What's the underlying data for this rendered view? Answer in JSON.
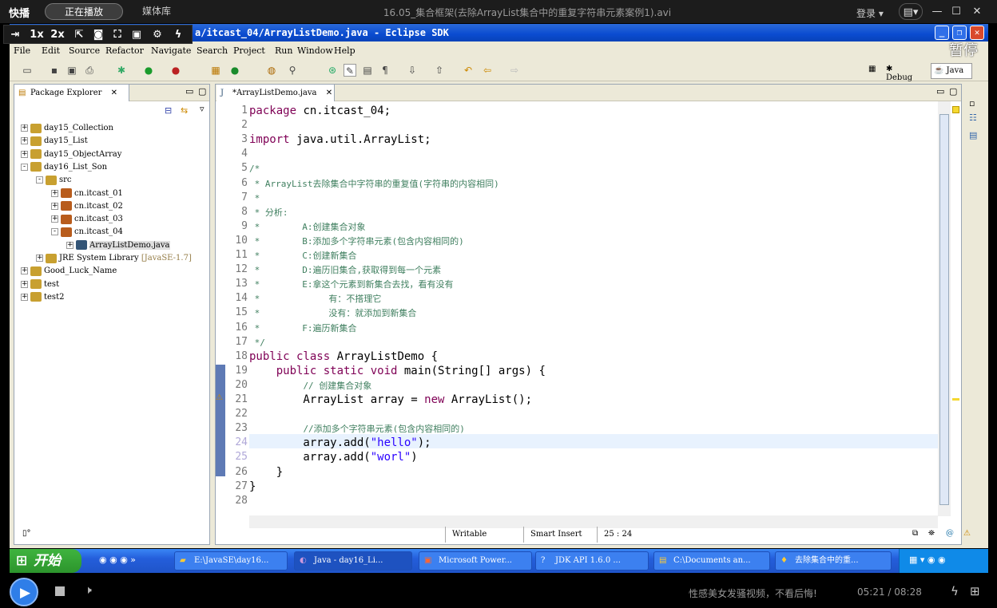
{
  "player": {
    "brand": "快播",
    "tabs": [
      "正在播放",
      "媒体库"
    ],
    "title": "16.05_集合框架(去除ArrayList集合中的重复字符串元素案例1).avi",
    "login": "登录",
    "speed_1x": "1x",
    "speed_2x": "2x",
    "pause_overlay": "暂停",
    "ad_text": "性感美女发骚视频，不看后悔!",
    "time": "05:21 / 08:28",
    "accent": "#2f7ee8"
  },
  "eclipse": {
    "title": "a/itcast_04/ArrayListDemo.java - Eclipse SDK",
    "menu": [
      "File",
      "Edit",
      "Source",
      "Refactor",
      "Navigate",
      "Search",
      "Project",
      "Run",
      "Window",
      "Help"
    ],
    "perspectives": [
      "Debug",
      "Java"
    ],
    "package_explorer": {
      "title": "Package Explorer",
      "items": [
        {
          "label": "day15_Collection",
          "depth": 0,
          "expander": "+"
        },
        {
          "label": "day15_List",
          "depth": 0,
          "expander": "+"
        },
        {
          "label": "day15_ObjectArray",
          "depth": 0,
          "expander": "+"
        },
        {
          "label": "day16_List_Son",
          "depth": 0,
          "expander": "-"
        },
        {
          "label": "src",
          "depth": 1,
          "expander": "-"
        },
        {
          "label": "cn.itcast_01",
          "depth": 2,
          "expander": "+"
        },
        {
          "label": "cn.itcast_02",
          "depth": 2,
          "expander": "+"
        },
        {
          "label": "cn.itcast_03",
          "depth": 2,
          "expander": "+"
        },
        {
          "label": "cn.itcast_04",
          "depth": 2,
          "expander": "-"
        },
        {
          "label": "ArrayListDemo.java",
          "depth": 3,
          "expander": "+"
        },
        {
          "label": "JRE System Library",
          "depth": 1,
          "expander": "+",
          "suffix": "[JavaSE-1.7]"
        },
        {
          "label": "Good_Luck_Name",
          "depth": 0,
          "expander": "+"
        },
        {
          "label": "test",
          "depth": 0,
          "expander": "+"
        },
        {
          "label": "test2",
          "depth": 0,
          "expander": "+"
        }
      ]
    },
    "editor": {
      "tab": "*ArrayListDemo.java",
      "lines": [
        {
          "n": "1",
          "parts": [
            [
              "kw",
              "package"
            ],
            [
              "",
              " cn.itcast_04;"
            ]
          ]
        },
        {
          "n": "2",
          "parts": []
        },
        {
          "n": "3",
          "parts": [
            [
              "kw",
              "import"
            ],
            [
              "",
              " java.util.ArrayList;"
            ]
          ]
        },
        {
          "n": "4",
          "parts": []
        },
        {
          "n": "5",
          "parts": [
            [
              "cm",
              "/*"
            ]
          ]
        },
        {
          "n": "6",
          "parts": [
            [
              "cm",
              " * ArrayList去除集合中字符串的重复值(字符串的内容相同)"
            ]
          ]
        },
        {
          "n": "7",
          "parts": [
            [
              "cm",
              " *"
            ]
          ]
        },
        {
          "n": "8",
          "parts": [
            [
              "cm",
              " * 分析:"
            ]
          ]
        },
        {
          "n": "9",
          "parts": [
            [
              "cm",
              " *        A:创建集合对象"
            ]
          ]
        },
        {
          "n": "10",
          "parts": [
            [
              "cm",
              " *        B:添加多个字符串元素(包含内容相同的)"
            ]
          ]
        },
        {
          "n": "11",
          "parts": [
            [
              "cm",
              " *        C:创建新集合"
            ]
          ]
        },
        {
          "n": "12",
          "parts": [
            [
              "cm",
              " *        D:遍历旧集合,获取得到每一个元素"
            ]
          ]
        },
        {
          "n": "13",
          "parts": [
            [
              "cm",
              " *        E:拿这个元素到新集合去找，看有没有"
            ]
          ]
        },
        {
          "n": "14",
          "parts": [
            [
              "cm",
              " *             有：不搭理它"
            ]
          ]
        },
        {
          "n": "15",
          "parts": [
            [
              "cm",
              " *             没有：就添加到新集合"
            ]
          ]
        },
        {
          "n": "16",
          "parts": [
            [
              "cm",
              " *        F:遍历新集合"
            ]
          ]
        },
        {
          "n": "17",
          "parts": [
            [
              "cm",
              " */"
            ]
          ]
        },
        {
          "n": "18",
          "parts": [
            [
              "kw",
              "public class"
            ],
            [
              "",
              " ArrayListDemo {"
            ]
          ]
        },
        {
          "n": "19",
          "parts": [
            [
              "",
              "    "
            ],
            [
              "kw",
              "public static void"
            ],
            [
              "",
              " main(String[] args) {"
            ]
          ]
        },
        {
          "n": "20",
          "parts": [
            [
              "",
              "        "
            ],
            [
              "cm",
              "// 创建集合对象"
            ]
          ]
        },
        {
          "n": "21",
          "parts": [
            [
              "",
              "        ArrayList array = "
            ],
            [
              "kw",
              "new"
            ],
            [
              "",
              " ArrayList();"
            ]
          ]
        },
        {
          "n": "22",
          "parts": []
        },
        {
          "n": "23",
          "parts": [
            [
              "",
              "        "
            ],
            [
              "cm",
              "//添加多个字符串元素(包含内容相同的)"
            ]
          ]
        },
        {
          "n": "24",
          "parts": [
            [
              "",
              "        array.add("
            ],
            [
              "st",
              "\"hello\""
            ],
            [
              "",
              ");"
            ]
          ]
        },
        {
          "n": "25",
          "parts": [
            [
              "",
              "        array.add("
            ],
            [
              "st",
              "\"worl\""
            ],
            [
              "",
              ")"
            ]
          ]
        },
        {
          "n": "26",
          "parts": [
            [
              "",
              "    }"
            ]
          ]
        },
        {
          "n": "27",
          "parts": [
            [
              "",
              "}"
            ]
          ]
        },
        {
          "n": "28",
          "parts": []
        }
      ]
    },
    "status": {
      "writable": "Writable",
      "insert": "Smart Insert",
      "position": "25 : 24"
    }
  },
  "taskbar": {
    "start": "开始",
    "items": [
      "E:\\JavaSE\\day16...",
      "Java - day16_Li...",
      "Microsoft Power...",
      "JDK API 1.6.0 ...",
      "C:\\Documents an...",
      "去除集合中的重..."
    ]
  }
}
